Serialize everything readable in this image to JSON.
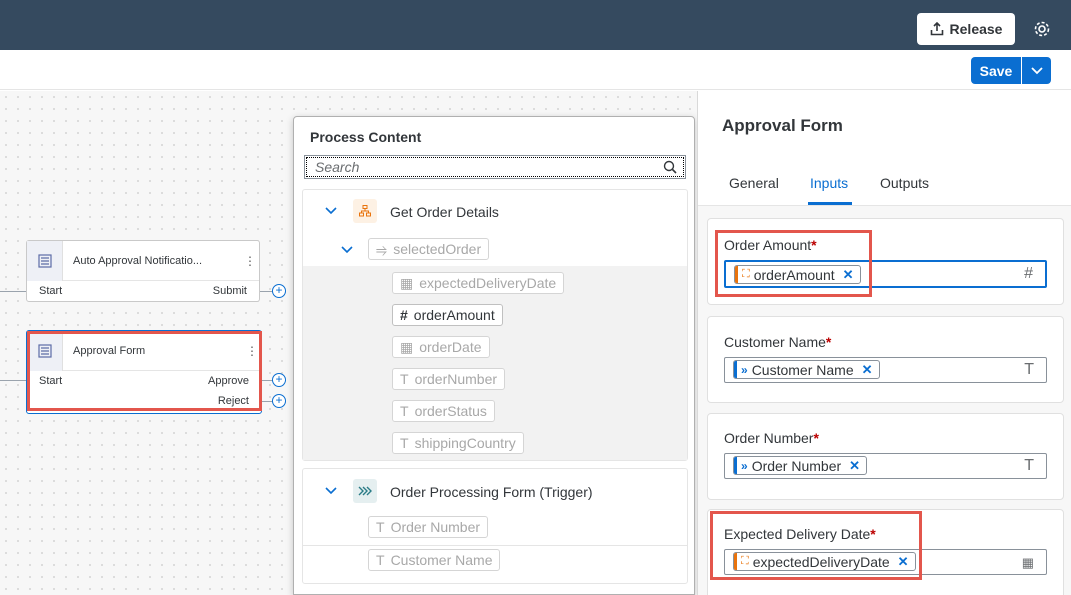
{
  "header": {
    "release_label": "Release",
    "save_label": "Save"
  },
  "canvas": {
    "auto_node": {
      "title": "Auto Approval Notificatio...",
      "start": "Start",
      "submit": "Submit"
    },
    "approval_node": {
      "title": "Approval Form",
      "start": "Start",
      "approve": "Approve",
      "reject": "Reject"
    }
  },
  "process_content": {
    "title": "Process Content",
    "search_placeholder": "Search",
    "group1": {
      "label": "Get Order Details",
      "sub": "selectedOrder",
      "items": [
        {
          "label": "expectedDeliveryDate",
          "type": "calendar"
        },
        {
          "label": "orderAmount",
          "type": "#"
        },
        {
          "label": "orderDate",
          "type": "calendar"
        },
        {
          "label": "orderNumber",
          "type": "T"
        },
        {
          "label": "orderStatus",
          "type": "T"
        },
        {
          "label": "shippingCountry",
          "type": "T"
        }
      ]
    },
    "group2": {
      "label": "Order Processing Form (Trigger)",
      "items": [
        {
          "label": "Order Number",
          "type": "T"
        },
        {
          "label": "Customer Name",
          "type": "T"
        }
      ]
    }
  },
  "panel": {
    "title": "Approval Form",
    "tabs": [
      "General",
      "Inputs",
      "Outputs"
    ],
    "active_tab": "Inputs",
    "fields": [
      {
        "label": "Order Amount",
        "token": "orderAmount",
        "type_icon": "#"
      },
      {
        "label": "Customer Name",
        "token": "Customer Name",
        "type_icon": "T"
      },
      {
        "label": "Order Number",
        "token": "Order Number",
        "type_icon": "T"
      },
      {
        "label": "Expected Delivery Date",
        "token": "expectedDeliveryDate",
        "type_icon": "calendar"
      }
    ]
  },
  "colors": {
    "shell": "#354a5f",
    "accent": "#0a6ed1",
    "highlight": "#e3564c",
    "action_token": "#e9730c",
    "trigger_token": "#0a6ed1"
  }
}
